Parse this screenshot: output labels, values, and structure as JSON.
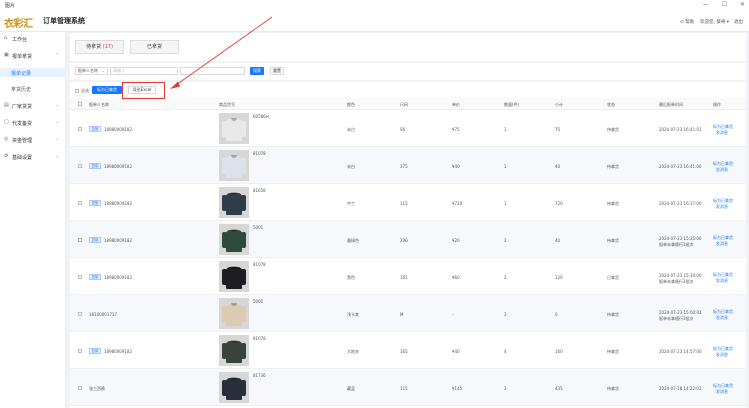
{
  "window": {
    "title": "图片",
    "min": "—",
    "max": "☐",
    "close": "✕"
  },
  "header": {
    "logo": "衣彩汇",
    "system_name": "订单管理系统",
    "help": "帮助",
    "user": "欢迎您, 葵奇 ▾",
    "exit": "退出"
  },
  "sidebar": {
    "items": [
      {
        "icon": "⌂",
        "label": "工作台",
        "arrow": ""
      },
      {
        "icon": "▣",
        "label": "报单拿货",
        "arrow": "^"
      },
      {
        "icon": "",
        "label": "报单记录",
        "arrow": "",
        "sub": true,
        "active": true
      },
      {
        "icon": "",
        "label": "拿货历史",
        "arrow": "",
        "sub": true
      },
      {
        "icon": "▤",
        "label": "厂家货货",
        "arrow": "⌄"
      },
      {
        "icon": "▢",
        "label": "代发备货",
        "arrow": "⌄"
      },
      {
        "icon": "◎",
        "label": "资金管理",
        "arrow": "⌄"
      },
      {
        "icon": "⚙",
        "label": "基础设置",
        "arrow": "⌄"
      }
    ]
  },
  "tabs": {
    "pending_label": "待拿货",
    "pending_count": "(17)",
    "done_label": "已拿货"
  },
  "filter": {
    "select_label": "报单人名称",
    "input_placeholder": "请输入",
    "search_label": "搜索",
    "reset_label": "重置"
  },
  "toolbar": {
    "select_all": "全选",
    "mark_taken": "标为已拿货",
    "export": "导出Excel"
  },
  "columns": [
    "报单人名称",
    "商品货号",
    "颜色",
    "尺码",
    "单价",
    "数量(件)",
    "小计",
    "状态",
    "最后报单时间",
    "操作"
  ],
  "rows": [
    {
      "badge": "复制",
      "name": "18980009182",
      "code": "60586H",
      "color": "米白",
      "size": "S6",
      "price": "¥75",
      "qty": "1",
      "subtotal": "75",
      "status": "待拿货",
      "time": "2024-07-23 16:41:01",
      "time2": "",
      "shirt": "#e9e9ea",
      "op1": "标为已拿货",
      "op2": "发消息"
    },
    {
      "badge": "复制",
      "name": "18980009182",
      "code": "81078",
      "color": "米白",
      "size": "175",
      "price": "¥40",
      "qty": "1",
      "subtotal": "40",
      "status": "待拿货",
      "time": "2024-07-23 16:41:00",
      "time2": "",
      "shirt": "#dde2ea",
      "op1": "标为已拿货",
      "op2": "发消息"
    },
    {
      "badge": "复制",
      "name": "18980009182",
      "code": "81658",
      "color": "中兰",
      "size": "115",
      "price": "¥720",
      "qty": "1",
      "subtotal": "720",
      "status": "待拿货",
      "time": "2024-07-23 16:17:00",
      "time2": "",
      "shirt": "#2f3d48",
      "op1": "标为已拿货",
      "op2": "发消息"
    },
    {
      "badge": "复制",
      "name": "18980009182",
      "code": "5001",
      "color": "墨绿色",
      "size": "290",
      "price": "¥20",
      "qty": "2",
      "subtotal": "40",
      "status": "待拿货",
      "time": "2024-07-23 15:35:00",
      "time2": "报单未拿随行1批次",
      "shirt": "#2f4a3e",
      "op1": "标为已拿货",
      "op2": "发消息"
    },
    {
      "badge": "复制",
      "name": "18980009182",
      "code": "81078",
      "color": "黑色",
      "size": "165",
      "price": "¥60",
      "qty": "2",
      "subtotal": "120",
      "status": "已拿货",
      "time": "2024-07-23 15:34:00",
      "time2": "报单未拿随行1批次",
      "shirt": "#1e1e22",
      "op1": "标为已拿货",
      "op2": "发消息"
    },
    {
      "badge": "",
      "name": "18100001717",
      "code": "5005",
      "color": "浅卡其",
      "size": "M",
      "price": "-",
      "qty": "3",
      "subtotal": "0",
      "status": "待拿货",
      "time": "2024-07-23 15:00:01",
      "time2": "报单未拿随行3批次",
      "shirt": "#dccab5",
      "op1": "标为已拿货",
      "op2": "发消息"
    },
    {
      "badge": "复制",
      "name": "18980009182",
      "code": "81078",
      "color": "大地灰",
      "size": "165",
      "price": "¥40",
      "qty": "4",
      "subtotal": "160",
      "status": "待拿货",
      "time": "2024-07-23 14:57:00",
      "time2": "",
      "shirt": "#3a423e",
      "op1": "标为已拿货",
      "op2": "发消息"
    },
    {
      "badge": "",
      "name": "张三西裤",
      "code": "81736",
      "color": "藏蓝",
      "size": "115",
      "price": "¥145",
      "qty": "3",
      "subtotal": "435",
      "status": "待拿货",
      "time": "2024-07-18 14:22:01",
      "time2": "",
      "shirt": "#2a2d3a",
      "op1": "标为已拿货",
      "op2": "发消息"
    }
  ]
}
